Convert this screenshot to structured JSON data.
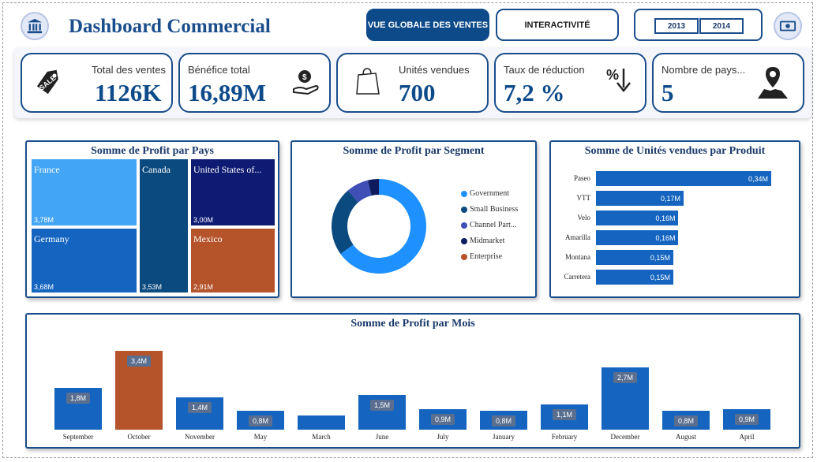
{
  "header": {
    "title": "Dashboard Commercial",
    "left_icon": "bank-icon",
    "right_icon": "money-bill-icon",
    "tabs": [
      {
        "label": "VUE GLOBALE DES VENTES",
        "active": true
      },
      {
        "label": "INTERACTIVITÉ",
        "active": false
      }
    ],
    "years": [
      "2013",
      "2014"
    ]
  },
  "kpis": [
    {
      "label": "Total des ventes",
      "value": "1126K",
      "icon": "sale-tag-icon"
    },
    {
      "label": "Bénéfice total",
      "value": "16,89M",
      "icon": "money-hand-icon"
    },
    {
      "label": "Unités vendues",
      "value": "700",
      "icon": "shopping-bag-icon"
    },
    {
      "label": "Taux de réduction",
      "value": "7,2 %",
      "icon": "percent-down-icon"
    },
    {
      "label": "Nombre de pays...",
      "value": "5",
      "icon": "map-pin-icon"
    }
  ],
  "colors": {
    "primary": "#0d4a8a",
    "accent": "#1565c0",
    "highlight": "#b5532a",
    "france": "#42a5f5",
    "canada": "#0b4a7e",
    "usa": "#0e1b73",
    "germany": "#1565c0",
    "mexico": "#b5532a"
  },
  "charts": {
    "by_country": {
      "title": "Somme de Profit par Pays",
      "chart_data": {
        "type": "treemap",
        "items": [
          {
            "name": "France",
            "value": 3.78,
            "label": "3,78M"
          },
          {
            "name": "Germany",
            "value": 3.68,
            "label": "3,68M"
          },
          {
            "name": "Canada",
            "value": 3.53,
            "label": "3,53M"
          },
          {
            "name": "United States of...",
            "value": 3.0,
            "label": "3,00M"
          },
          {
            "name": "Mexico",
            "value": 2.91,
            "label": "2,91M"
          }
        ]
      }
    },
    "by_segment": {
      "title": "Somme de Profit par Segment",
      "chart_data": {
        "type": "pie",
        "donut": true,
        "labels": [
          "Government",
          "Small Business",
          "Channel Part...",
          "Midmarket",
          "Enterprise"
        ],
        "values": [
          11.39,
          4.14,
          1.32,
          0.66,
          -0.61
        ],
        "colors": [
          "#1e90ff",
          "#0b4a7e",
          "#3f4fb5",
          "#0e1b5e",
          "#b5532a"
        ]
      }
    },
    "by_product": {
      "title": "Somme de Unités vendues par Produit",
      "chart_data": {
        "type": "bar",
        "orientation": "horizontal",
        "categories": [
          "Paseo",
          "VTT",
          "Velo",
          "Amarilla",
          "Montana",
          "Carretera"
        ],
        "values": [
          0.34,
          0.17,
          0.16,
          0.16,
          0.15,
          0.15
        ],
        "labels": [
          "0,34M",
          "0,17M",
          "0,16M",
          "0,16M",
          "0,15M",
          "0,15M"
        ]
      }
    },
    "by_month": {
      "title": "Somme de Profit par Mois",
      "chart_data": {
        "type": "bar",
        "categories": [
          "September",
          "October",
          "November",
          "May",
          "March",
          "June",
          "July",
          "January",
          "February",
          "December",
          "August",
          "April"
        ],
        "values": [
          1.8,
          3.4,
          1.4,
          0.8,
          0.6,
          1.5,
          0.9,
          0.8,
          1.1,
          2.7,
          0.8,
          0.9
        ],
        "labels": [
          "1,8M",
          "3,4M",
          "1,4M",
          "0,8M",
          "",
          "1,5M",
          "0,9M",
          "0,8M",
          "1,1M",
          "2,7M",
          "0,8M",
          "0,9M"
        ],
        "highlight_index": 1
      }
    }
  }
}
